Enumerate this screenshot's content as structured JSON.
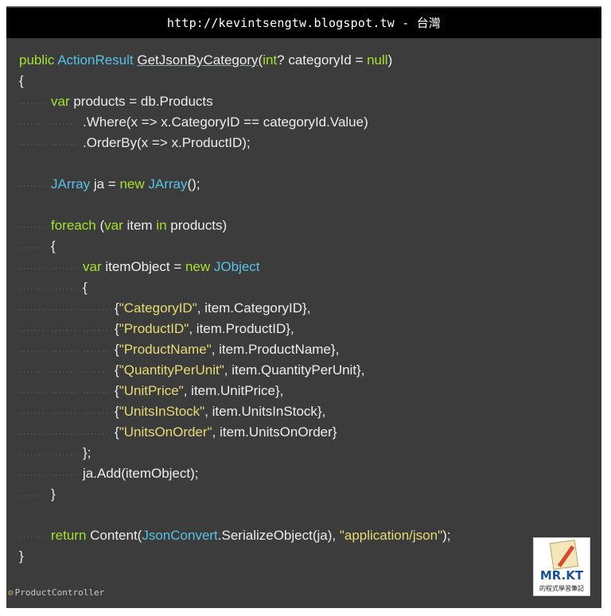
{
  "header": {
    "title": "http://kevintsengtw.blogspot.tw - 台灣"
  },
  "code_lines": [
    {
      "indent": 0,
      "tokens": [
        {
          "t": "public ",
          "c": "kw"
        },
        {
          "t": "ActionResult ",
          "c": "ty"
        },
        {
          "t": "GetJsonByCategory",
          "c": "nm",
          "u": true
        },
        {
          "t": "(",
          "c": "nm"
        },
        {
          "t": "int",
          "c": "kw"
        },
        {
          "t": "? categoryId = ",
          "c": "nm"
        },
        {
          "t": "null",
          "c": "kw"
        },
        {
          "t": ")",
          "c": "nm"
        }
      ]
    },
    {
      "indent": 0,
      "tokens": [
        {
          "t": "{",
          "c": "nm"
        }
      ]
    },
    {
      "indent": 1,
      "tokens": [
        {
          "t": "var ",
          "c": "kw"
        },
        {
          "t": "products = db.Products",
          "c": "nm"
        }
      ]
    },
    {
      "indent": 2,
      "tokens": [
        {
          "t": ".Where(x => x.CategoryID == categoryId.Value)",
          "c": "nm"
        }
      ]
    },
    {
      "indent": 2,
      "tokens": [
        {
          "t": ".OrderBy(x => x.ProductID);",
          "c": "nm"
        }
      ]
    },
    {
      "indent": 0,
      "tokens": []
    },
    {
      "indent": 1,
      "tokens": [
        {
          "t": "JArray",
          "c": "ty"
        },
        {
          "t": " ja = ",
          "c": "nm"
        },
        {
          "t": "new ",
          "c": "kw"
        },
        {
          "t": "JArray",
          "c": "ty"
        },
        {
          "t": "();",
          "c": "nm"
        }
      ]
    },
    {
      "indent": 0,
      "tokens": []
    },
    {
      "indent": 1,
      "tokens": [
        {
          "t": "foreach ",
          "c": "kw"
        },
        {
          "t": "(",
          "c": "nm"
        },
        {
          "t": "var ",
          "c": "kw"
        },
        {
          "t": "item ",
          "c": "nm"
        },
        {
          "t": "in ",
          "c": "kw"
        },
        {
          "t": "products)",
          "c": "nm"
        }
      ]
    },
    {
      "indent": 1,
      "tokens": [
        {
          "t": "{",
          "c": "nm"
        }
      ]
    },
    {
      "indent": 2,
      "tokens": [
        {
          "t": "var ",
          "c": "kw"
        },
        {
          "t": "itemObject = ",
          "c": "nm"
        },
        {
          "t": "new ",
          "c": "kw"
        },
        {
          "t": "JObject",
          "c": "ty"
        }
      ]
    },
    {
      "indent": 2,
      "tokens": [
        {
          "t": "{",
          "c": "nm"
        }
      ]
    },
    {
      "indent": 3,
      "tokens": [
        {
          "t": "{",
          "c": "nm"
        },
        {
          "t": "\"CategoryID\"",
          "c": "st"
        },
        {
          "t": ", item.CategoryID},",
          "c": "nm"
        }
      ]
    },
    {
      "indent": 3,
      "tokens": [
        {
          "t": "{",
          "c": "nm"
        },
        {
          "t": "\"ProductID\"",
          "c": "st"
        },
        {
          "t": ", item.ProductID},",
          "c": "nm"
        }
      ]
    },
    {
      "indent": 3,
      "tokens": [
        {
          "t": "{",
          "c": "nm"
        },
        {
          "t": "\"ProductName\"",
          "c": "st"
        },
        {
          "t": ", item.ProductName},",
          "c": "nm"
        }
      ]
    },
    {
      "indent": 3,
      "tokens": [
        {
          "t": "{",
          "c": "nm"
        },
        {
          "t": "\"QuantityPerUnit\"",
          "c": "st"
        },
        {
          "t": ", item.QuantityPerUnit},",
          "c": "nm"
        }
      ]
    },
    {
      "indent": 3,
      "tokens": [
        {
          "t": "{",
          "c": "nm"
        },
        {
          "t": "\"UnitPrice\"",
          "c": "st"
        },
        {
          "t": ", item.UnitPrice},",
          "c": "nm"
        }
      ]
    },
    {
      "indent": 3,
      "tokens": [
        {
          "t": "{",
          "c": "nm"
        },
        {
          "t": "\"UnitsInStock\"",
          "c": "st"
        },
        {
          "t": ", item.UnitsInStock},",
          "c": "nm"
        }
      ]
    },
    {
      "indent": 3,
      "tokens": [
        {
          "t": "{",
          "c": "nm"
        },
        {
          "t": "\"UnitsOnOrder\"",
          "c": "st"
        },
        {
          "t": ", item.UnitsOnOrder}",
          "c": "nm"
        }
      ]
    },
    {
      "indent": 2,
      "tokens": [
        {
          "t": "};",
          "c": "nm"
        }
      ]
    },
    {
      "indent": 2,
      "tokens": [
        {
          "t": "ja.Add(itemObject);",
          "c": "nm"
        }
      ]
    },
    {
      "indent": 1,
      "tokens": [
        {
          "t": "}",
          "c": "nm"
        }
      ]
    },
    {
      "indent": 0,
      "tokens": []
    },
    {
      "indent": 1,
      "tokens": [
        {
          "t": "return ",
          "c": "kw"
        },
        {
          "t": "Content(",
          "c": "nm"
        },
        {
          "t": "JsonConvert",
          "c": "ty"
        },
        {
          "t": ".SerializeObject(ja), ",
          "c": "nm"
        },
        {
          "t": "\"application/json\"",
          "c": "st"
        },
        {
          "t": ");",
          "c": "nm"
        }
      ]
    },
    {
      "indent": 0,
      "tokens": [
        {
          "t": "}",
          "c": "nm"
        }
      ]
    }
  ],
  "footer": {
    "icon": "class-icon",
    "label": "ProductController"
  },
  "watermark": {
    "brand": "MR.KT",
    "subtitle": "的程式學習筆記"
  },
  "colors": {
    "keyword": "#a6e22e",
    "type": "#56c2e6",
    "string": "#e6db74",
    "text": "#ececec",
    "background": "#3c3c3c"
  }
}
